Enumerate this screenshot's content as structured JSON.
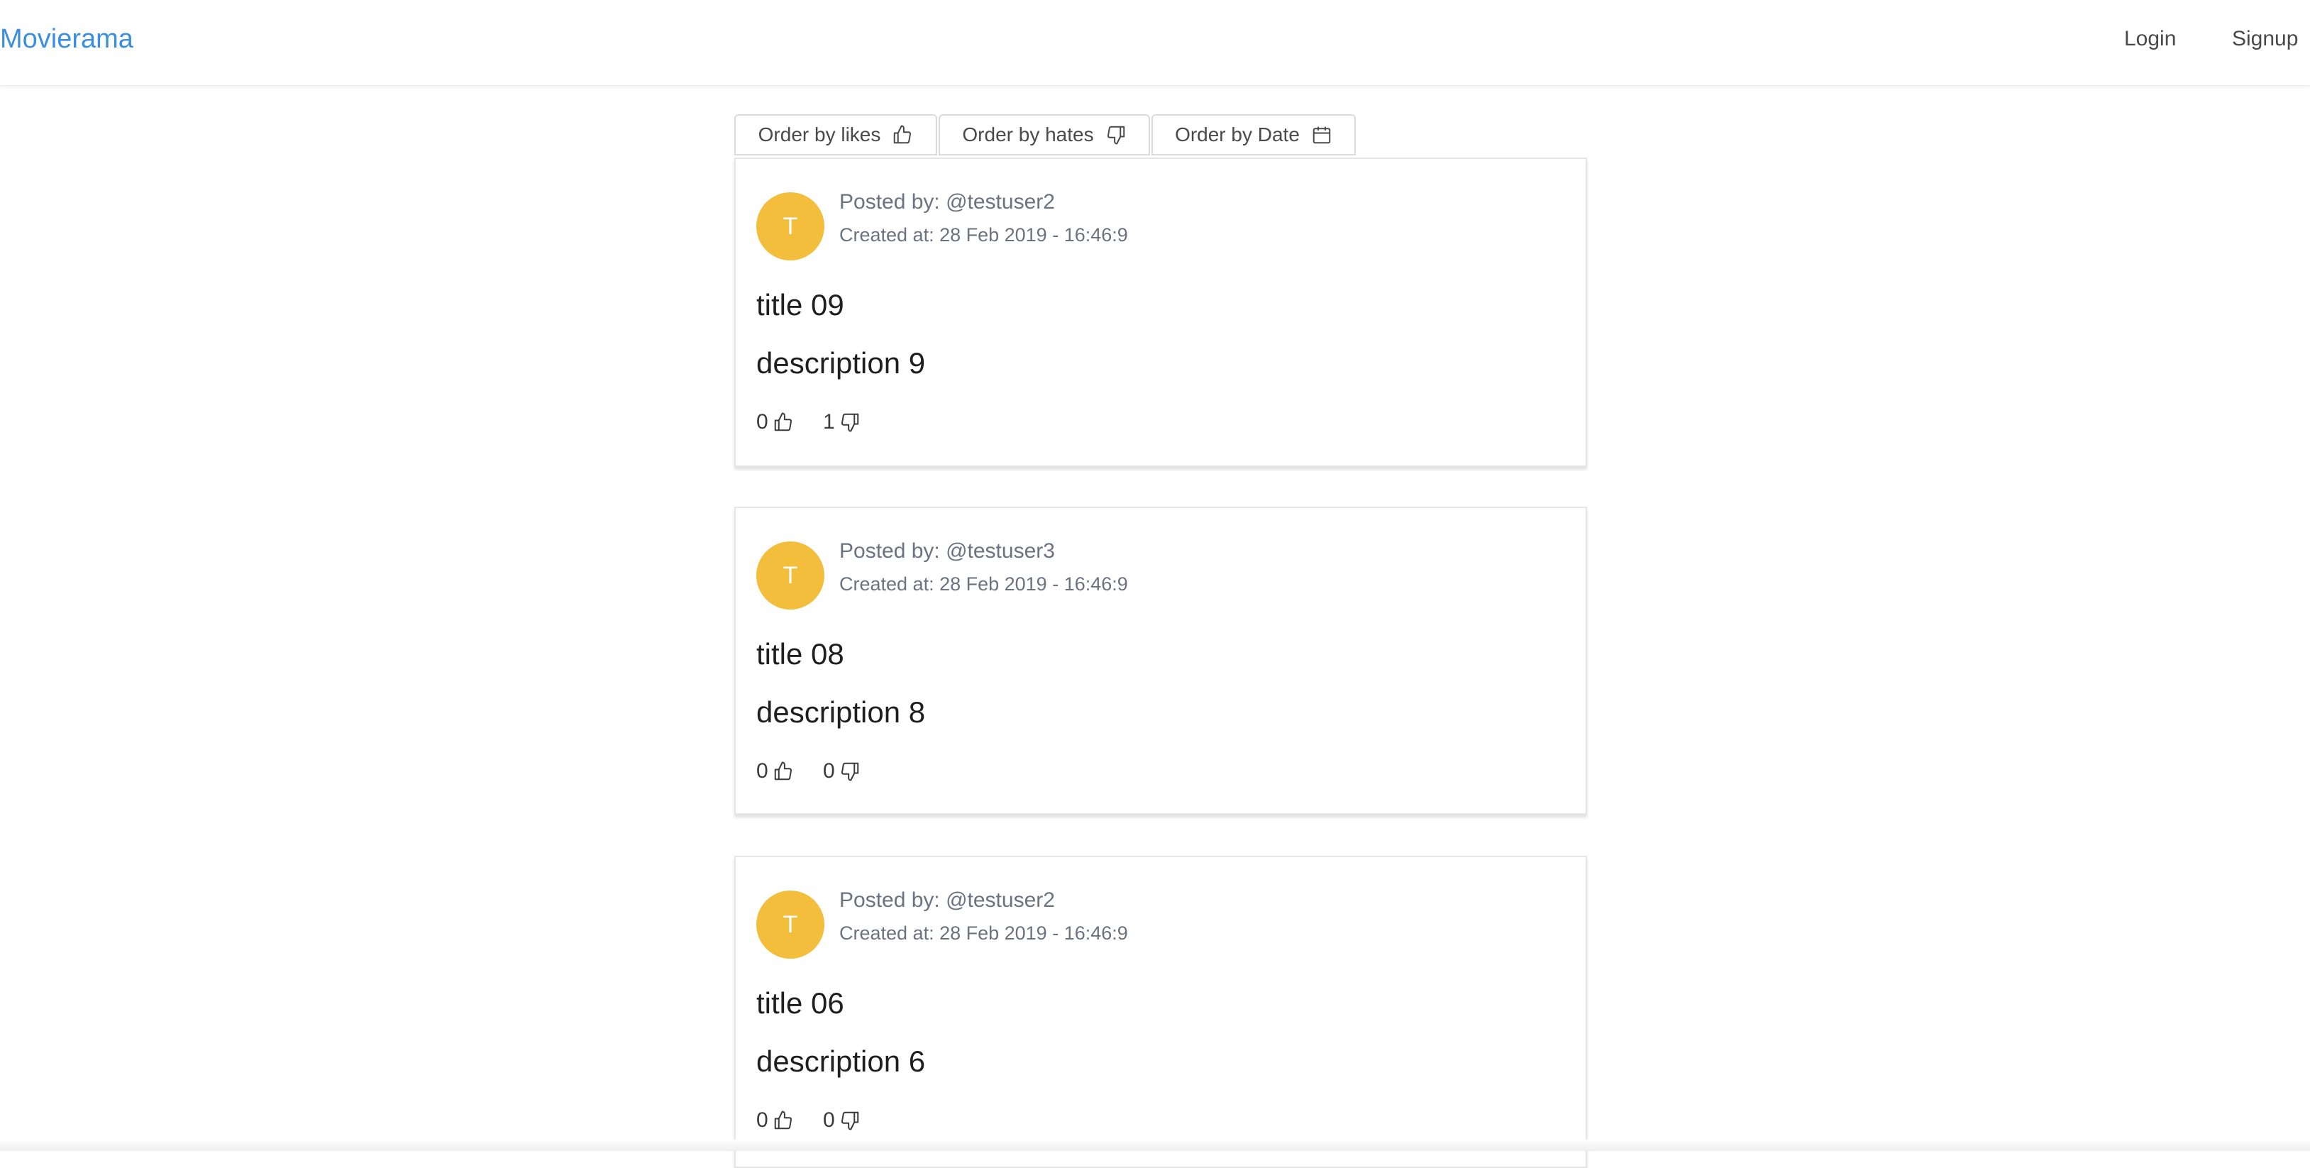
{
  "navbar": {
    "brand": "Movierama",
    "login_label": "Login",
    "signup_label": "Signup"
  },
  "order": {
    "likes_label": "Order by likes",
    "hates_label": "Order by hates",
    "date_label": "Order by Date"
  },
  "posts": [
    {
      "avatar_letter": "T",
      "posted_by": "Posted by: @testuser2",
      "created_at": "Created at: 28 Feb 2019 - 16:46:9",
      "title": "title 09",
      "description": "description 9",
      "likes": "0",
      "hates": "1"
    },
    {
      "avatar_letter": "T",
      "posted_by": "Posted by: @testuser3",
      "created_at": "Created at: 28 Feb 2019 - 16:46:9",
      "title": "title 08",
      "description": "description 8",
      "likes": "0",
      "hates": "0"
    },
    {
      "avatar_letter": "T",
      "posted_by": "Posted by: @testuser2",
      "created_at": "Created at: 28 Feb 2019 - 16:46:9",
      "title": "title 06",
      "description": "description 6",
      "likes": "0",
      "hates": "0"
    }
  ],
  "colors": {
    "brand": "#3b8fde",
    "avatar": "#f3be3c",
    "meta_text": "#6b7380"
  },
  "icons": {
    "like": "thumbs-up-icon",
    "hate": "thumbs-down-icon",
    "date": "calendar-icon"
  }
}
